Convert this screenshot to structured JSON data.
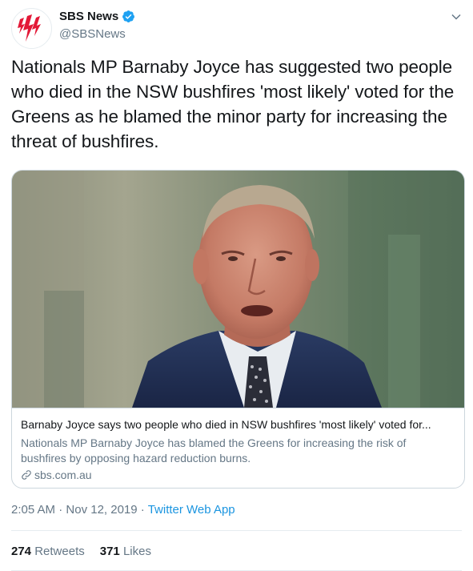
{
  "author": {
    "name": "SBS News",
    "handle": "@SBSNews",
    "verified": true,
    "avatar_icon": "sbs-logo-icon",
    "brand_color": "#e31837"
  },
  "tweet": {
    "text": "Nationals MP Barnaby Joyce has suggested two people who died in the NSW bushfires 'most likely' voted for the Greens as he blamed the minor party for increasing the threat of bushfires."
  },
  "card": {
    "title": "Barnaby Joyce says two people who died in NSW bushfires 'most likely' voted for...",
    "description": "Nationals MP Barnaby Joyce has blamed the Greens for increasing the risk of bushfires by opposing hazard reduction burns.",
    "domain": "sbs.com.au",
    "link_icon": "link-icon"
  },
  "meta": {
    "time": "2:05 AM",
    "separator1": " · ",
    "date": "Nov 12, 2019",
    "separator2": " · ",
    "app": "Twitter Web App"
  },
  "stats": {
    "retweets_count": "274",
    "retweets_label": "Retweets",
    "likes_count": "371",
    "likes_label": "Likes"
  },
  "colors": {
    "link": "#1b95e0",
    "verified": "#1da1f2",
    "muted": "#657786"
  }
}
